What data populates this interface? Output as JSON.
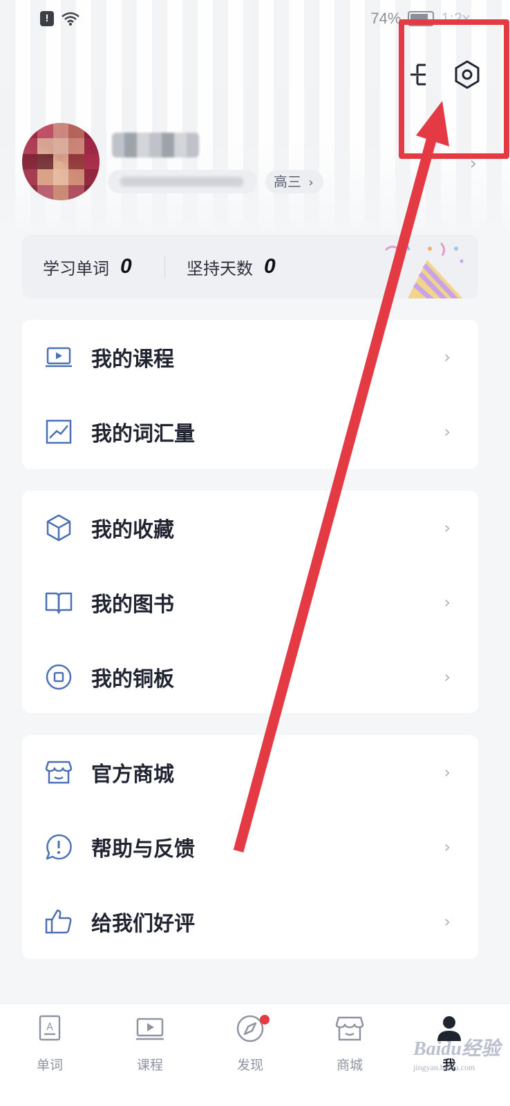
{
  "status_bar": {
    "battery": "74%",
    "time": "1:2x"
  },
  "profile": {
    "grade": "高三"
  },
  "stats": [
    {
      "label": "学习单词",
      "value": "0"
    },
    {
      "label": "坚持天数",
      "value": "0"
    }
  ],
  "menu_groups": [
    [
      {
        "label": "我的课程",
        "icon": "laptop-play-icon"
      },
      {
        "label": "我的词汇量",
        "icon": "chart-line-icon"
      }
    ],
    [
      {
        "label": "我的收藏",
        "icon": "cube-icon"
      },
      {
        "label": "我的图书",
        "icon": "book-icon"
      },
      {
        "label": "我的铜板",
        "icon": "coin-icon"
      }
    ],
    [
      {
        "label": "官方商城",
        "icon": "store-icon"
      },
      {
        "label": "帮助与反馈",
        "icon": "feedback-icon"
      },
      {
        "label": "给我们好评",
        "icon": "thumbs-up-icon"
      }
    ]
  ],
  "tabs": [
    {
      "label": "单词",
      "icon": "word-card-icon"
    },
    {
      "label": "课程",
      "icon": "course-icon"
    },
    {
      "label": "发现",
      "icon": "compass-icon"
    },
    {
      "label": "商城",
      "icon": "store-icon"
    },
    {
      "label": "我",
      "icon": "person-icon",
      "active": true
    }
  ],
  "watermark": {
    "brand": "Baidu经验",
    "url": "jingyan.baidu.com"
  },
  "colors": {
    "accent": "#4a6fb5",
    "annotation": "#e33a44",
    "badge": "#e33a44"
  }
}
